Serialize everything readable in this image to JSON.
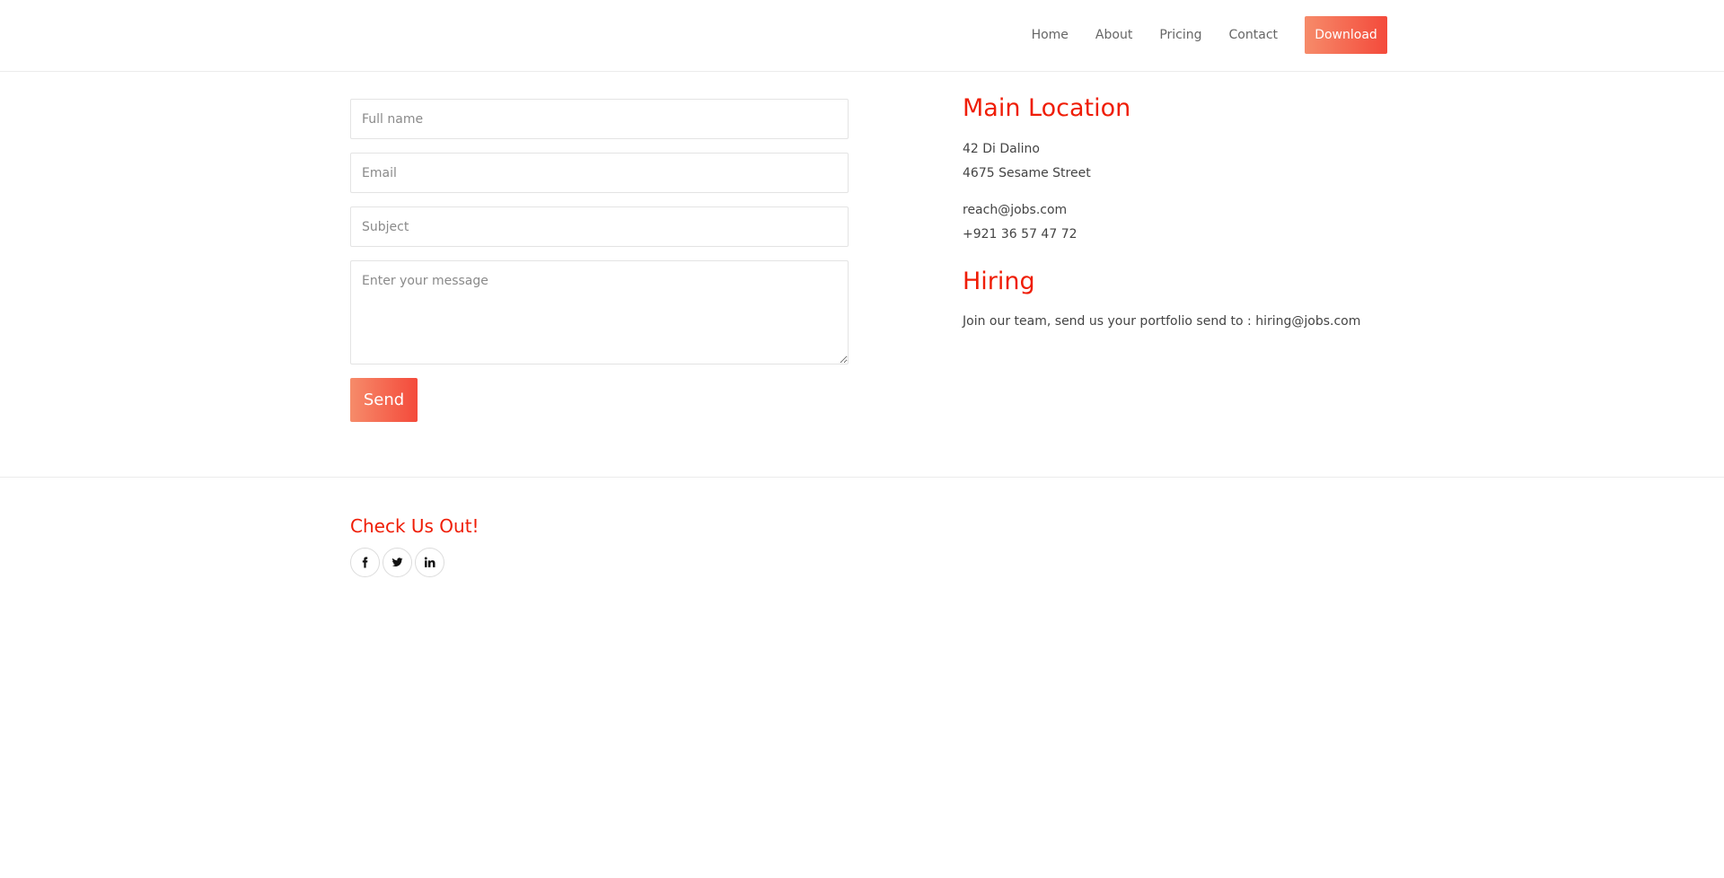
{
  "nav": {
    "items": [
      {
        "label": "Home"
      },
      {
        "label": "About"
      },
      {
        "label": "Pricing"
      },
      {
        "label": "Contact"
      }
    ],
    "download_label": "Download"
  },
  "form": {
    "full_name_placeholder": "Full name",
    "email_placeholder": "Email",
    "subject_placeholder": "Subject",
    "message_placeholder": "Enter your message",
    "send_label": "Send"
  },
  "location": {
    "title": "Main Location",
    "address_line1": "42 Di Dalino",
    "address_line2": "4675 Sesame Street",
    "email": "reach@jobs.com",
    "phone": "+921 36 57 47 72"
  },
  "hiring": {
    "title": "Hiring",
    "text": "Join our team, send us your portfolio send to : hiring@jobs.com"
  },
  "footer": {
    "title": "Check Us Out!",
    "socials": [
      {
        "icon": "facebook-icon"
      },
      {
        "icon": "twitter-icon"
      },
      {
        "icon": "linkedin-icon"
      }
    ]
  },
  "colors": {
    "accent": "#ef1d06",
    "button_gradient_start": "#f68b6a",
    "button_gradient_end": "#f44a3b"
  }
}
